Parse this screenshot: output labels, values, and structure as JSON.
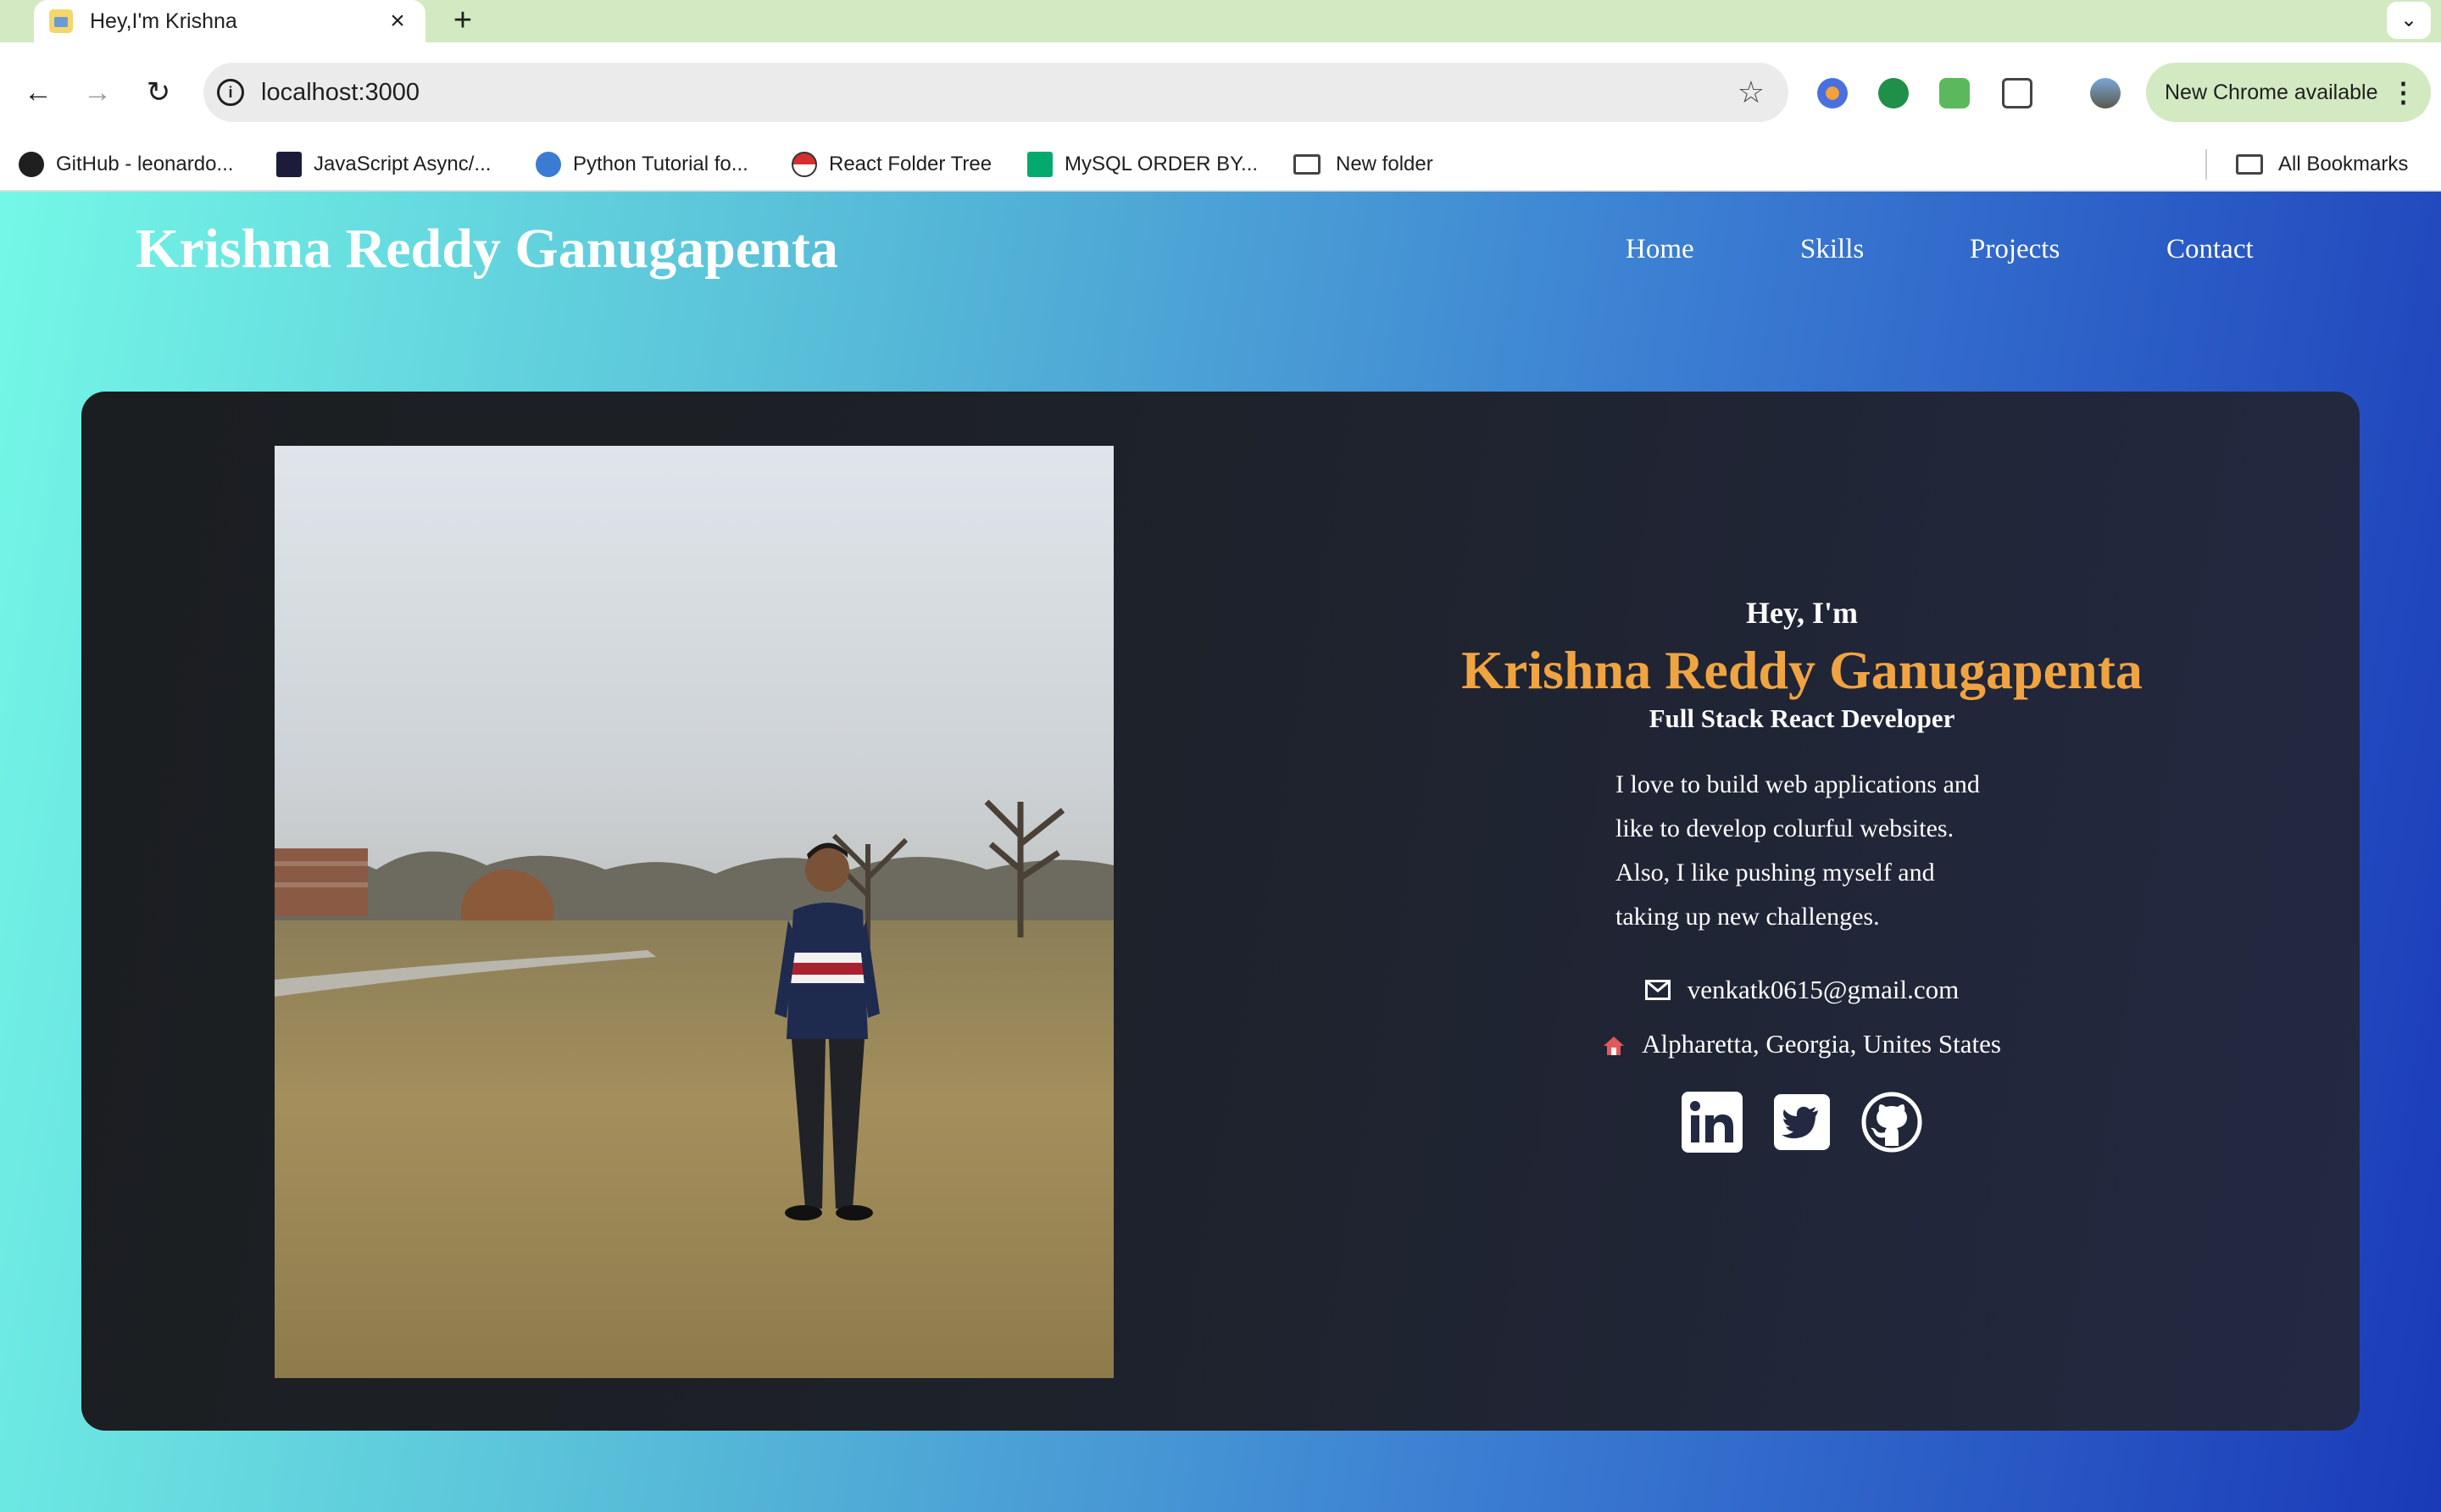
{
  "browser": {
    "tab_title": "Hey,I'm Krishna",
    "url": "localhost:3000",
    "update_button": "New Chrome available",
    "bookmarks": [
      {
        "label": "GitHub - leonardo...",
        "icon": "github-icon"
      },
      {
        "label": "JavaScript Async/...",
        "icon": "js-bookmark-icon"
      },
      {
        "label": "Python Tutorial fo...",
        "icon": "python-bookmark-icon"
      },
      {
        "label": "React Folder Tree",
        "icon": "react-bookmark-icon"
      },
      {
        "label": "MySQL ORDER BY...",
        "icon": "w3-bookmark-icon"
      },
      {
        "label": "New folder",
        "icon": "folder-icon"
      }
    ],
    "all_bookmarks": "All Bookmarks"
  },
  "site": {
    "logo": "Krishna Reddy Ganugapenta",
    "nav": [
      "Home",
      "Skills",
      "Projects",
      "Contact"
    ]
  },
  "hero": {
    "greeting": "Hey, I'm",
    "name": "Krishna Reddy Ganugapenta",
    "role": "Full Stack React Developer",
    "bio": "I love to build web applications and like to develop colurful websites. Also, I like pushing myself and taking up new challenges.",
    "email": "venkatk0615@gmail.com",
    "location": "Alpharetta, Georgia, Unites States",
    "socials": [
      "linkedin-icon",
      "twitter-icon",
      "github-icon"
    ]
  },
  "colors": {
    "accent_name": "#f0a441",
    "tabbar": "#d3e9c1"
  }
}
